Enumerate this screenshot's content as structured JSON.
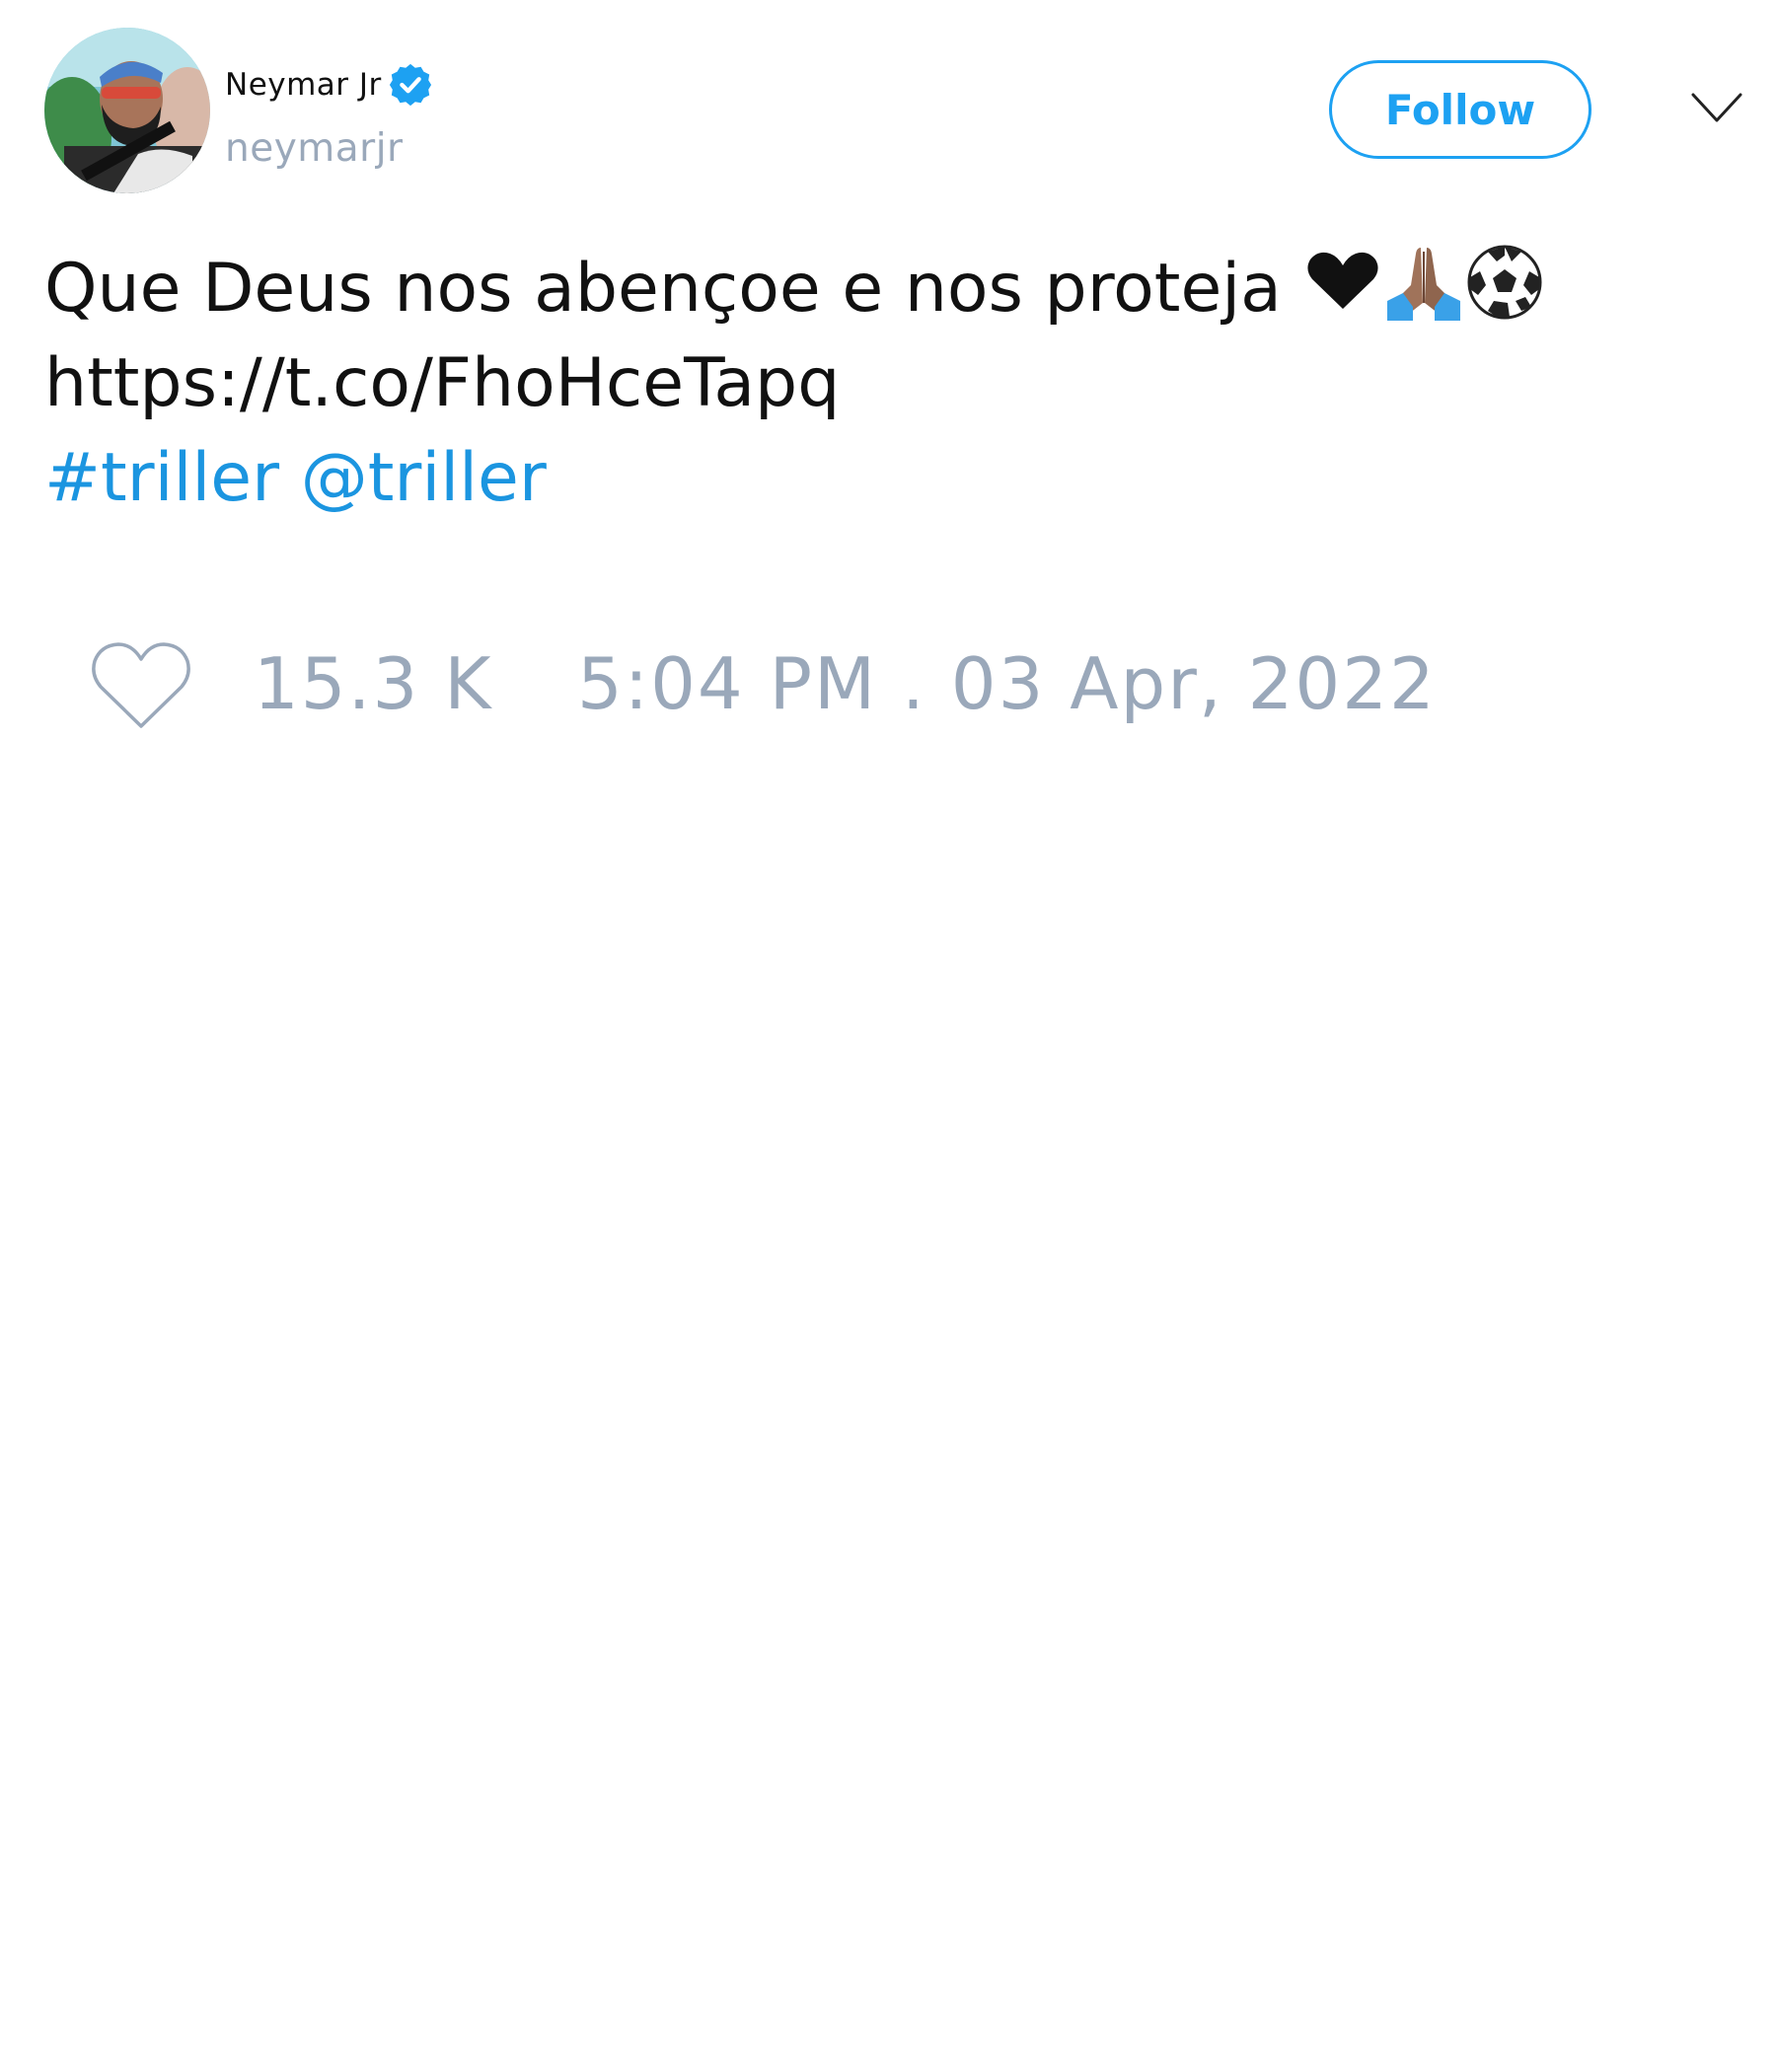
{
  "author": {
    "display_name": "Neymar Jr",
    "handle": "neymarjr",
    "verified": true,
    "avatar_icon": "profile-photo"
  },
  "header": {
    "follow_label": "Follow",
    "menu_icon": "chevron-down-icon"
  },
  "tweet": {
    "line1_text": "Que Deus nos abençoe e nos proteja ",
    "line1_emojis": [
      "heart-emoji",
      "folded-hands-emoji",
      "soccer-ball-emoji"
    ],
    "link": "https://t.co/FhoHceTapq",
    "hashtag": "#triller",
    "mention": "@triller"
  },
  "footer": {
    "like_icon": "heart-outline-icon",
    "like_count": "15.3 K",
    "timestamp": "5:04 PM . 03 Apr, 2022"
  },
  "colors": {
    "accent": "#1da1f2",
    "link": "#1b95e0",
    "muted": "#9aa8ba",
    "text": "#111111",
    "background": "#ffffff"
  }
}
